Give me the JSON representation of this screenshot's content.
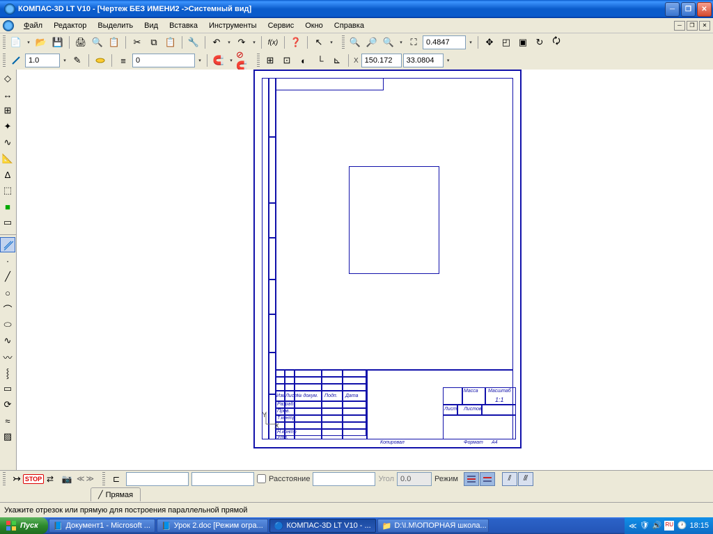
{
  "window": {
    "title": "КОМПАС-3D LT V10 - [Чертеж БЕЗ ИМЕНИ2 ->Системный вид]"
  },
  "menu": {
    "file": "Файл",
    "edit": "Редактор",
    "select": "Выделить",
    "view": "Вид",
    "insert": "Вставка",
    "tools": "Инструменты",
    "service": "Сервис",
    "window": "Окно",
    "help": "Справка"
  },
  "fileLetters": {
    "file": "Ф",
    "edit": "Р",
    "select": "В",
    "view": "В",
    "insert": "с",
    "tools": "И",
    "service": "е",
    "window": "О",
    "help": "С"
  },
  "toolbar_values": {
    "line_weight": "1.0",
    "layer": "0",
    "zoom": "0.4847",
    "coord_x": "150.172",
    "coord_y": "33.0804"
  },
  "cmd_panel": {
    "distance_label": "Расстояние",
    "distance_value": "",
    "angle_label": "Угол",
    "angle_value": "0.0",
    "mode_label": "Режим",
    "tab_label": "Прямая"
  },
  "statusbar": {
    "hint": "Укажите отрезок или прямую для построения параллельной прямой"
  },
  "taskbar": {
    "start": "Пуск",
    "tasks": [
      "Документ1 - Microsoft ...",
      "Урок 2.doc [Режим огра...",
      "КОМПАС-3D LT V10 - ...",
      "D:\\I.M\\ОПОРНАЯ школа..."
    ],
    "time": "18:15"
  },
  "titleblock": {
    "kopiroval": "Копировал",
    "format": "Формат",
    "format_val": "A4",
    "list": "Лист",
    "listov": "Листов",
    "massa": "Масса",
    "masshtab": "Масштаб",
    "scale": "1:1",
    "razrab": "Разраб.",
    "prov": "Пров.",
    "tkontr": "Т.контр",
    "nkontr": "Н.контр",
    "utv": "Утв.",
    "izm": "Изм",
    "list_hdr": "Лист",
    "ndokum": "№ докум.",
    "podp": "Подп.",
    "data": "Дата"
  }
}
